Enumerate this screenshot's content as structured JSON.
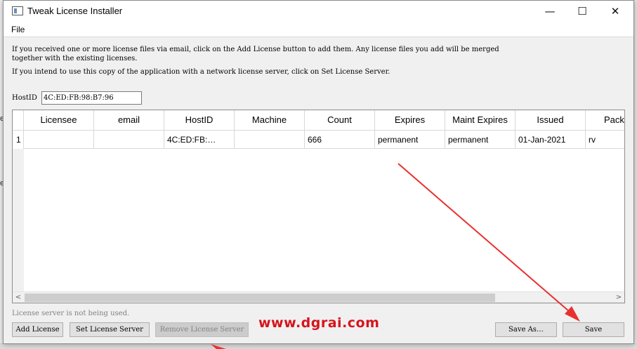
{
  "window": {
    "title": "Tweak License Installer",
    "controls": {
      "minimize": "—",
      "maximize": "☐",
      "close": "✕"
    }
  },
  "menu": {
    "file": "File"
  },
  "info": {
    "line1": "If you received one or more license files via email, click on the Add License button to add them. Any license files you add will be merged",
    "line2": "together with the existing licenses.",
    "line3": "If you intend to use this copy of the application with a network license server, click on Set License Server."
  },
  "hostid": {
    "label": "HostID",
    "value": "4C:ED:FB:98:B7:96"
  },
  "table": {
    "columns": [
      "Licensee",
      "email",
      "HostID",
      "Machine",
      "Count",
      "Expires",
      "Maint Expires",
      "Issued",
      "Packa"
    ],
    "rows": [
      {
        "index": "1",
        "cells": [
          "",
          "",
          "4C:ED:FB:…",
          "",
          "666",
          "permanent",
          "permanent",
          "01-Jan-2021",
          "rv"
        ]
      }
    ],
    "scroll_left": "<",
    "scroll_right": ">"
  },
  "status": "License server is not being used.",
  "buttons": {
    "add_license": "Add License",
    "set_license_server": "Set License Server",
    "remove_license_server": "Remove License Server",
    "save_as": "Save As…",
    "save": "Save"
  },
  "watermark": "www.dgrai.com",
  "background": {
    "letter1": "e",
    "letter2": "e"
  },
  "colors": {
    "annotation_arrow": "#e8312f",
    "watermark": "#d6141c",
    "disabled_text": "#838383"
  }
}
